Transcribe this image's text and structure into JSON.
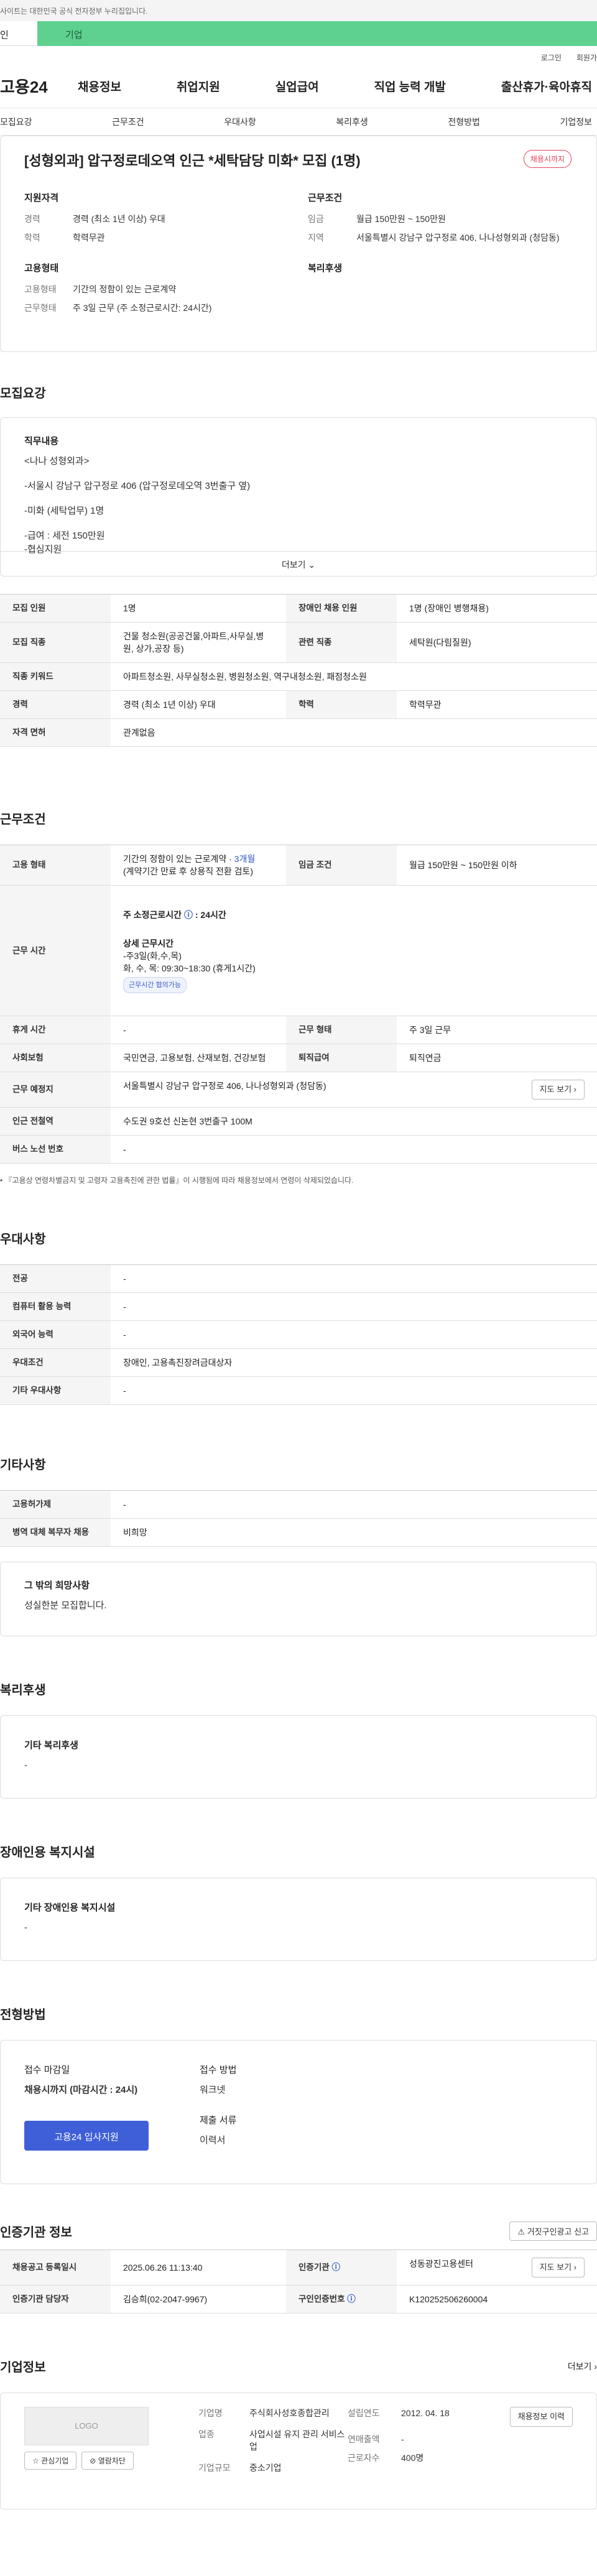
{
  "header": {
    "gov_banner": "사이트는 대한민국 공식 전자정부 누리집입니다.",
    "tab_personal": "인",
    "tab_company": "기업",
    "login": "로그인",
    "signup": "회원가",
    "logo": "고용24",
    "menu": [
      "채용정보",
      "취업지원",
      "실업급여",
      "직업 능력 개발",
      "출산휴가·육아휴직"
    ]
  },
  "subnav": [
    "모집요강",
    "근무조건",
    "우대사항",
    "복리후생",
    "전형방법",
    "기업정보"
  ],
  "job": {
    "title": "[성형외과] 압구정로데오역 인근 *세탁담당 미화* 모집 (1명)",
    "status_badge": "채용시까지",
    "qualification": {
      "heading": "지원자격",
      "rows": [
        {
          "k": "경력",
          "v": "경력 (최소 1년 이상) 우대"
        },
        {
          "k": "학력",
          "v": "학력무관"
        }
      ]
    },
    "conditions": {
      "heading": "근무조건",
      "rows": [
        {
          "k": "임금",
          "v": "월급 150만원 ~ 150만원"
        },
        {
          "k": "지역",
          "v": "서울특별시 강남구 압구정로 406, 나나성형외과 (청담동)"
        }
      ]
    },
    "employment": {
      "heading": "고용형태",
      "rows": [
        {
          "k": "고용형태",
          "v": "기간의 정함이 있는 근로계약"
        },
        {
          "k": "근무형태",
          "v": "주 3일 근무 (주 소정근로시간: 24시간)"
        }
      ]
    },
    "welfare": {
      "heading": "복리후생"
    }
  },
  "recruit": {
    "title": "모집요강",
    "duties_heading": "직무내용",
    "duties_lines": [
      "<나나 성형외과>",
      "-서울시 강남구 압구정로 406 (압구정로데오역 3번출구 옆)",
      "-미화 (세탁업무) 1명",
      "-급여 : 세전 150만원",
      "-협심지원"
    ],
    "more": "더보기",
    "table": [
      [
        {
          "h": "모집 인원"
        },
        {
          "v": "1명"
        },
        {
          "h": "장애인 채용 인원"
        },
        {
          "v": "1명 (장애인 병행채용)"
        }
      ],
      [
        {
          "h": "모집 직종"
        },
        {
          "v": "건물 청소원(공공건물,아파트,사무실,병원, 상가,공장 등)"
        },
        {
          "h": "관련 직종"
        },
        {
          "v": "세탁원(다림질원)"
        }
      ],
      [
        {
          "h": "직종 키워드"
        },
        {
          "v": "아파트청소원, 사무실청소원, 병원청소원, 역구내청소원, 패점청소원",
          "span": 3
        }
      ],
      [
        {
          "h": "경력"
        },
        {
          "v": "경력 (최소 1년 이상) 우대"
        },
        {
          "h": "학력"
        },
        {
          "v": "학력무관"
        }
      ],
      [
        {
          "h": "자격 면허"
        },
        {
          "v": "관계없음",
          "span": 3
        }
      ]
    ]
  },
  "work": {
    "title": "근무조건",
    "employment_type_label": "고용 형태",
    "employment_type": "기간의 정함이 있는 근로계약 ·",
    "employment_period": "3개월",
    "employment_note": "(계약기간 만료 후 상용직 전환 검토)",
    "wage_label": "임금 조건",
    "wage": "월급 150만원 ~ 150만원 이하",
    "hours_label": "근무 시간",
    "weekly_hours": "주 소정근로시간",
    "weekly_hours_value": "24시간",
    "detail_heading": "상세 근무시간",
    "detail_lines": [
      "-주3일(화,수,목)",
      "화, 수, 목: 09:30~18:30 (휴게1시간)"
    ],
    "flex_chip": "근무시간 협의가능",
    "rest_label": "휴게 시간",
    "rest": "-",
    "shift_label": "근무 형태",
    "shift": "주 3일 근무",
    "insurance_label": "사회보험",
    "insurance": "국민연금, 고용보험, 산재보험, 건강보험",
    "severance_label": "퇴직급여",
    "severance": "퇴직연금",
    "place_label": "근무 예정지",
    "place": "서울특별시 강남구 압구정로 406, 나나성형외과 (청담동)",
    "map_button": "지도 보기",
    "subway_label": "인근 전철역",
    "subway": "수도권 9호선 신논현 3번출구 100M",
    "bus_label": "버스 노선 번호",
    "bus": "-",
    "law_note": "『고용상 연령차별금지 및 고령자 고용촉진에 관한 법률』이 시행됨에 따라 채용정보에서 연령이 삭제되었습니다."
  },
  "preference": {
    "title": "우대사항",
    "rows": [
      {
        "k": "전공",
        "v": "-"
      },
      {
        "k": "컴퓨터 활용 능력",
        "v": "-"
      },
      {
        "k": "외국어 능력",
        "v": "-"
      },
      {
        "k": "우대조건",
        "v": "장애인, 고용촉진장려금대상자"
      },
      {
        "k": "기타 우대사항",
        "v": "-"
      }
    ]
  },
  "etc": {
    "title": "기타사항",
    "rows": [
      {
        "k": "고용허가제",
        "v": "-"
      },
      {
        "k": "병역 대체 복무자 채용",
        "v": "비희망"
      }
    ],
    "hope_heading": "그 밖의 희망사항",
    "hope_text": "성실한분 모집합니다."
  },
  "benefits": {
    "title": "복리후생",
    "heading": "기타 복리후생",
    "text": "-"
  },
  "disability": {
    "title": "장애인용 복지시설",
    "heading": "기타 장애인용 복지시설",
    "text": "-"
  },
  "selection": {
    "title": "전형방법",
    "deadline_label": "접수 마감일",
    "deadline": "채용시까지 (마감시간 : 24시)",
    "method_label": "접수 방법",
    "method": "워크넷",
    "docs_label": "제출 서류",
    "docs": "이력서",
    "apply_button": "고용24 입사지원"
  },
  "cert": {
    "title": "인증기관 정보",
    "report_button": "거짓구인광고 신고",
    "rows": [
      [
        {
          "h": "채용공고 등록일시"
        },
        {
          "v": "2025.06.26 11:13:40"
        },
        {
          "h": "인증기관"
        },
        {
          "v": "성동광진고용센터"
        }
      ],
      [
        {
          "h": "인증기관 담당자"
        },
        {
          "v": "김승희(02-2047-9967)"
        },
        {
          "h": "구인인증번호"
        },
        {
          "v": "K120252506260004"
        }
      ]
    ],
    "map_button": "지도 보기"
  },
  "company": {
    "title": "기업정보",
    "more": "더보기",
    "logo_text": "LOGO",
    "interest": "관심기업",
    "block": "열람차단",
    "left": [
      {
        "k": "기업명",
        "v": "주식회사성호종합관리"
      },
      {
        "k": "업종",
        "v": "사업시설 유지 관리 서비스업"
      },
      {
        "k": "기업규모",
        "v": "중소기업"
      }
    ],
    "right": [
      {
        "k": "설립연도",
        "v": "2012. 04. 18"
      },
      {
        "k": "연매출액",
        "v": "-"
      },
      {
        "k": "근로자수",
        "v": "400명"
      }
    ],
    "view_jobs": "채용정보 이력"
  }
}
